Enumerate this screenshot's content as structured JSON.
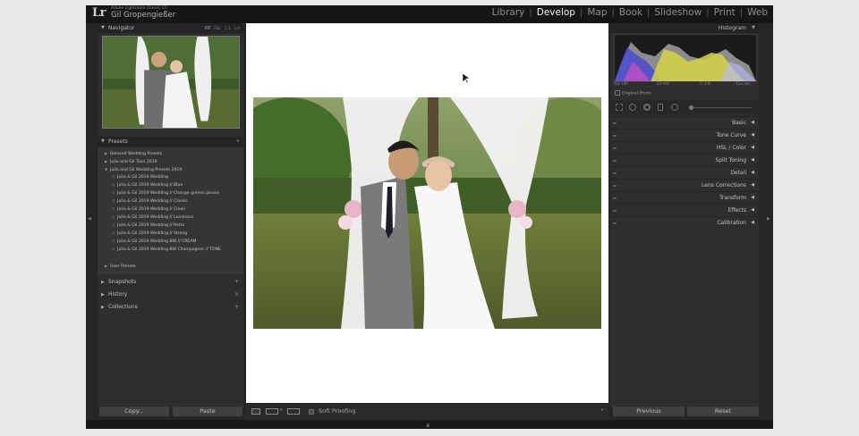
{
  "app": {
    "logo": "Lr",
    "product_line": "Adobe Lightroom Classic CC",
    "user_name": "Gil Gropengießer"
  },
  "modules": {
    "items": [
      {
        "label": "Library",
        "active": false
      },
      {
        "label": "Develop",
        "active": true
      },
      {
        "label": "Map",
        "active": false
      },
      {
        "label": "Book",
        "active": false
      },
      {
        "label": "Slideshow",
        "active": false
      },
      {
        "label": "Print",
        "active": false
      },
      {
        "label": "Web",
        "active": false
      }
    ],
    "separator": "|"
  },
  "navigator": {
    "title": "Navigator",
    "zoom_options": [
      "FIT",
      "FILL",
      "1:1",
      "1:4"
    ]
  },
  "presets": {
    "title": "Presets",
    "add": "+",
    "folders_top": [
      "Beloved Wedding Presets",
      "Julia and Gil Toon 2019",
      "Julia and Gil Wedding Presets 2019"
    ],
    "items": [
      "Julia & Gil 2019 Wedding",
      "Julia & Gil 2019 Wedding // Blue",
      "Julia & Gil 2019 Wedding // Change greens please",
      "Julia & Gil 2019 Wedding // Classic",
      "Julia & Gil 2019 Wedding // Clean",
      "Julia & Gil 2019 Wedding // Luminous",
      "Julia & Gil 2019 Wedding // Retro",
      "Julia & Gil 2019 Wedding // Strong",
      "Julia & Gil 2019 Wedding BW // CREAM",
      "Julia & Gil 2019 Wedding BW Champagner // TONE"
    ],
    "user_presets": "User Presets"
  },
  "left_sections": [
    {
      "label": "Snapshots",
      "action": "+"
    },
    {
      "label": "History",
      "action": "×"
    },
    {
      "label": "Collections",
      "action": "+"
    }
  ],
  "histogram": {
    "title": "Histogram",
    "iso": "ISO 100",
    "focal": "24 mm",
    "aperture": "f / 2.8",
    "shutter": "1/₂₅₀ sec",
    "original_photo": "Original Photo"
  },
  "develop_sections": [
    "Basic",
    "Tone Curve",
    "HSL / Color",
    "Split Toning",
    "Detail",
    "Lens Corrections",
    "Transform",
    "Effects",
    "Calibration"
  ],
  "left_buttons": {
    "copy": "Copy...",
    "paste": "Paste"
  },
  "right_buttons": {
    "previous": "Previous",
    "reset": "Reset"
  },
  "toolbar": {
    "soft_proofing": "Soft Proofing"
  },
  "colors": {
    "panel": "#2e2e2e",
    "header": "#242424",
    "active_module": "#f2f2f2",
    "inactive_module": "#8f8f8f"
  }
}
